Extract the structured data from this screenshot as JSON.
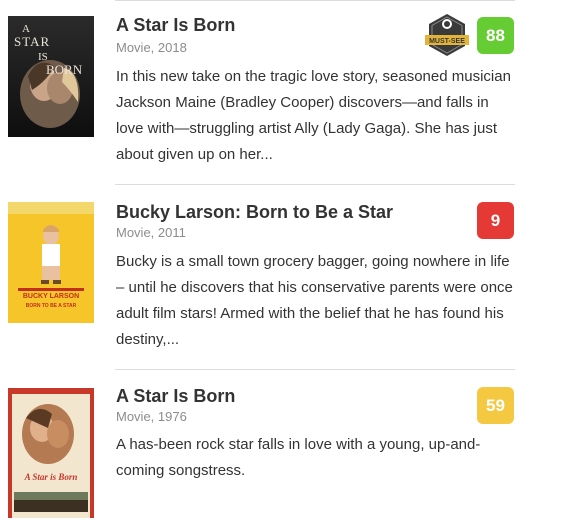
{
  "results": [
    {
      "title": "A Star Is Born",
      "meta": "Movie, 2018",
      "description": "In this new take on the tragic love story, seasoned musician Jackson Maine (Bradley Cooper) discovers—and falls in love with—struggling artist Ally (Lady Gaga). She has just about given up on her...",
      "score": "88",
      "score_color": "#66cc33",
      "badge": "MUST-SEE",
      "poster_text": [
        "A",
        "STAR",
        "IS",
        "BORN"
      ]
    },
    {
      "title": "Bucky Larson: Born to Be a Star",
      "meta": "Movie, 2011",
      "description": "Bucky is a small town grocery bagger, going nowhere in life – until he discovers that his conservative parents were once adult film stars! Armed with the belief that he has found his destiny,...",
      "score": "9",
      "score_color": "#e53935",
      "poster_text": [
        "BUCKY LARSON",
        "BORN TO BE A STAR"
      ]
    },
    {
      "title": "A Star Is Born",
      "meta": "Movie, 1976",
      "description": "A has-been rock star falls in love with a young, up-and-coming songstress.",
      "score": "59",
      "score_color": "#f5c842",
      "poster_text": [
        "A Star is Born"
      ]
    }
  ]
}
